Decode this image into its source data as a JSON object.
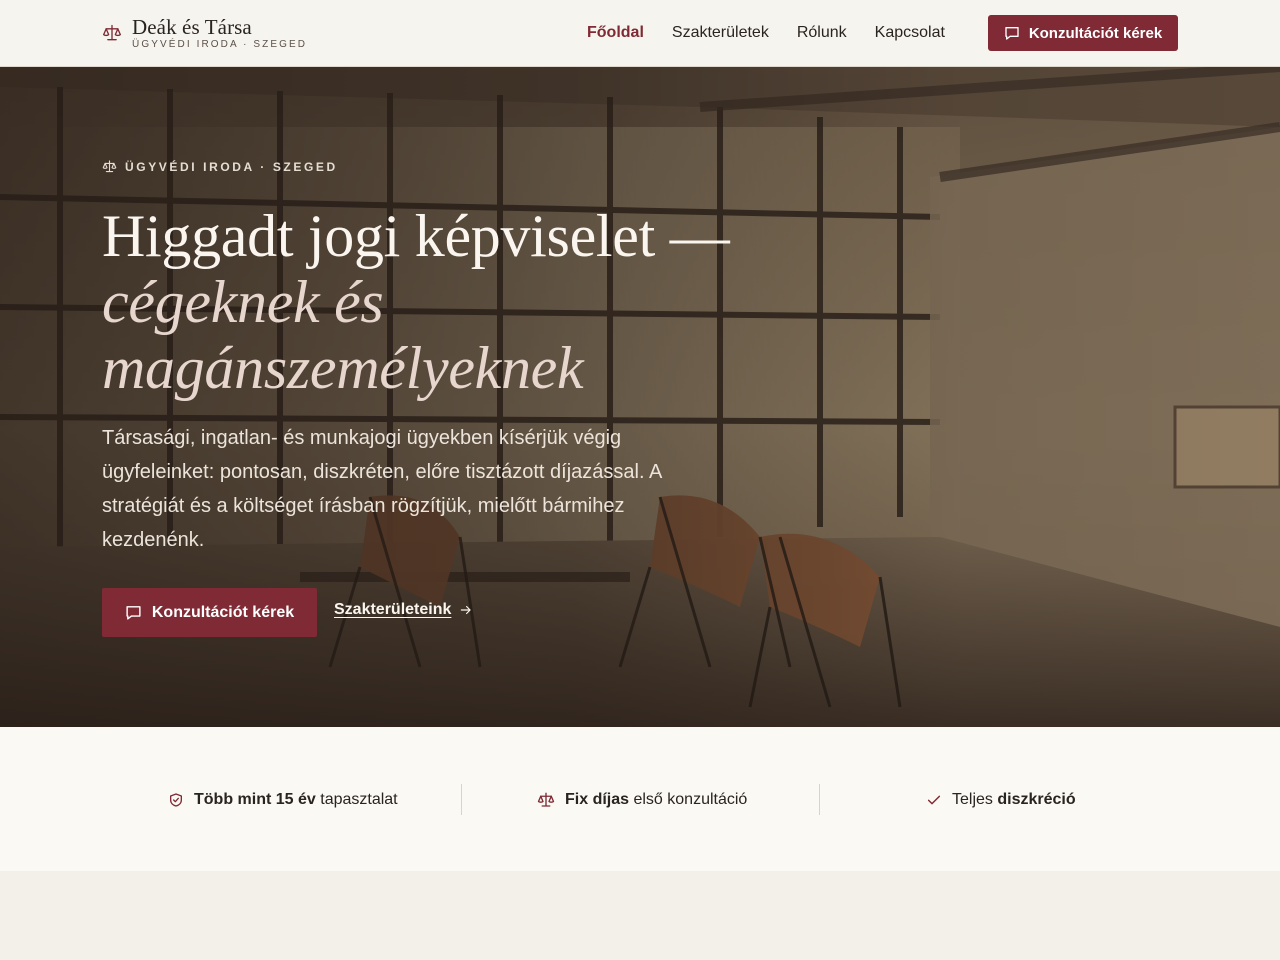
{
  "brand": {
    "name": "Deák és Társa",
    "subtitle": "ÜGYVÉDI IRODA · SZEGED",
    "icon": "scales-icon",
    "accent_color": "#7f2a34"
  },
  "nav": {
    "items": [
      {
        "label": "Főoldal",
        "active": true
      },
      {
        "label": "Szakterületek",
        "active": false
      },
      {
        "label": "Rólunk",
        "active": false
      },
      {
        "label": "Kapcsolat",
        "active": false
      }
    ],
    "cta_label": "Konzultációt kérek",
    "cta_icon": "chat-bubble-icon"
  },
  "hero": {
    "eyebrow": "ÜGYVÉDI IRODA · SZEGED",
    "title_plain": "Higgadt jogi képviselet —",
    "title_italic_1": "cégeknek",
    "title_italic_2": "és magánszemélyeknek",
    "lead": "Társasági, ingatlan- és munkajogi ügyekben kísérjük végig ügyfeleinket: pontosan, diszkréten, előre tisztázott díjazással. A stratégiát és a költséget írásban rögzítjük, mielőtt bármihez kezdenénk.",
    "primary_cta": "Konzultációt kérek",
    "secondary_cta": "Szakterületeink"
  },
  "trust": {
    "items": [
      {
        "icon": "shield-check-icon",
        "bold": "Több mint 15 év",
        "rest": " tapasztalat"
      },
      {
        "icon": "scales-icon",
        "bold": "Fix díjas",
        "rest": " első konzultáció"
      },
      {
        "icon": "check-icon",
        "prefix": "Teljes ",
        "bold": "diszkréció"
      }
    ]
  }
}
